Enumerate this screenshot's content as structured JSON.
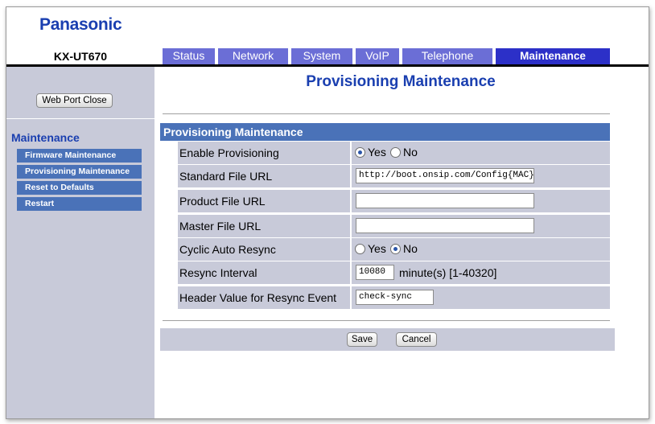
{
  "brand": "Panasonic",
  "model": "KX-UT670",
  "tabs": [
    {
      "label": "Status"
    },
    {
      "label": "Network"
    },
    {
      "label": "System"
    },
    {
      "label": "VoIP"
    },
    {
      "label": "Telephone"
    },
    {
      "label": "Maintenance",
      "active": true
    }
  ],
  "sidebar": {
    "web_port_close": "Web Port Close",
    "menu_title": "Maintenance",
    "items": [
      {
        "label": "Firmware Maintenance"
      },
      {
        "label": "Provisioning Maintenance"
      },
      {
        "label": "Reset to Defaults"
      },
      {
        "label": "Restart"
      }
    ]
  },
  "page": {
    "title": "Provisioning Maintenance",
    "section_title": "Provisioning Maintenance",
    "rows": {
      "enable_provisioning": {
        "label": "Enable Provisioning",
        "yes": "Yes",
        "no": "No",
        "selected": "Yes"
      },
      "standard_file_url": {
        "label": "Standard File URL",
        "value": "http://boot.onsip.com/Config{MAC}.cfg"
      },
      "product_file_url": {
        "label": "Product File URL",
        "value": ""
      },
      "master_file_url": {
        "label": "Master File URL",
        "value": ""
      },
      "cyclic_auto_resync": {
        "label": "Cyclic Auto Resync",
        "yes": "Yes",
        "no": "No",
        "selected": "No"
      },
      "resync_interval": {
        "label": "Resync Interval",
        "value": "10080",
        "unit": "minute(s) [1-40320]"
      },
      "header_value": {
        "label": "Header Value for Resync Event",
        "value": "check-sync"
      }
    },
    "save": "Save",
    "cancel": "Cancel"
  },
  "colors": {
    "brand_blue": "#1a3fb0",
    "tab": "#6b6ed6",
    "tab_active": "#2c30c8",
    "section_header": "#4a72b8",
    "panel": "#c8cad9"
  }
}
